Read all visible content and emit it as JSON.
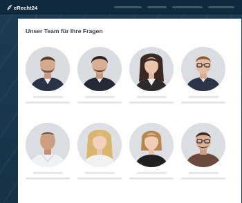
{
  "header": {
    "logo_text": "eRecht24",
    "logo_icon": "pen-nib-icon"
  },
  "section": {
    "title": "Unser Team für Ihre Fragen"
  },
  "team": [
    {
      "avatar": "man-beard-shirt-portrait"
    },
    {
      "avatar": "man-dark-hair-portrait"
    },
    {
      "avatar": "woman-long-dark-hair-portrait"
    },
    {
      "avatar": "man-glasses-portrait"
    },
    {
      "avatar": "man-bald-portrait"
    },
    {
      "avatar": "woman-blonde-portrait"
    },
    {
      "avatar": "woman-short-hair-portrait"
    },
    {
      "avatar": "man-glasses-dark-shirt-portrait"
    }
  ],
  "colors": {
    "background": "#1a3a52",
    "topbar": "#0f2a3d",
    "panel": "#ffffff",
    "title": "#2f3a44",
    "placeholder": "#e3e6ea"
  }
}
